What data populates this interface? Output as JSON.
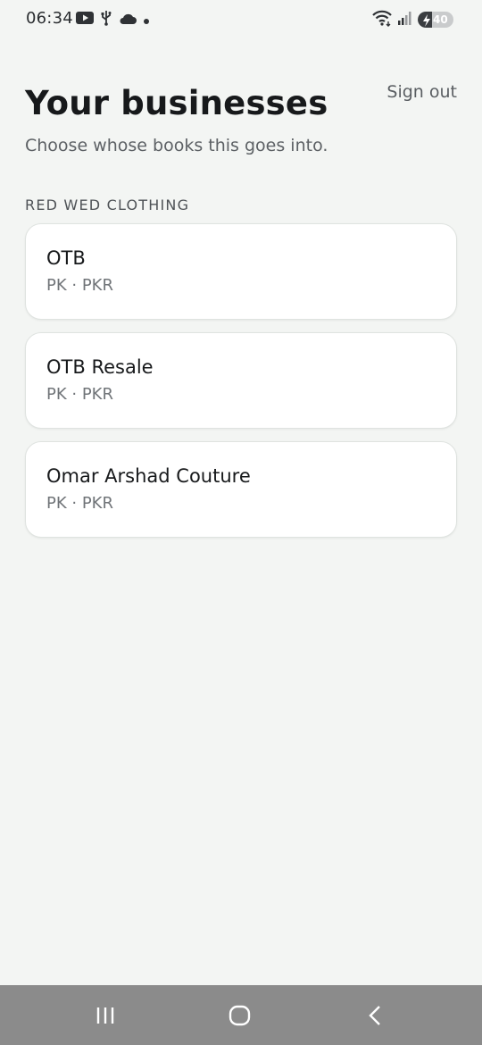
{
  "status_bar": {
    "time": "06:34",
    "battery_level": "40",
    "battery_fraction": 0.4,
    "left_icons": [
      "youtube-icon",
      "usb-icon",
      "cloud-icon",
      "dot-icon"
    ],
    "right_icons": [
      "wifi-icon",
      "signal-icon",
      "battery-icon"
    ]
  },
  "header": {
    "title": "Your businesses",
    "sign_out_label": "Sign out",
    "subtitle": "Choose whose books this goes into."
  },
  "group": {
    "label": "RED WED CLOTHING",
    "businesses": [
      {
        "name": "OTB",
        "meta": "PK · PKR"
      },
      {
        "name": "OTB Resale",
        "meta": "PK · PKR"
      },
      {
        "name": "Omar Arshad Couture",
        "meta": "PK · PKR"
      }
    ]
  },
  "nav_bar": {
    "buttons": [
      "recent-apps-icon",
      "home-icon",
      "back-icon"
    ]
  },
  "colors": {
    "background": "#f3f5f3",
    "card": "#ffffff",
    "nav_bar": "#8b8b8b",
    "title": "#17191b"
  }
}
